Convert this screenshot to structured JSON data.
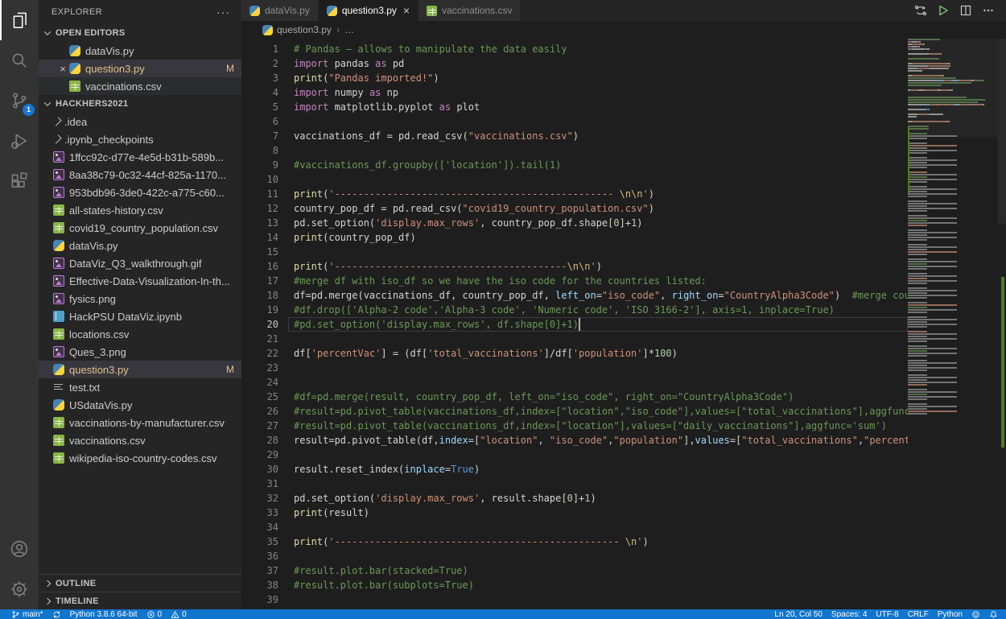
{
  "activity_bar": {
    "items": [
      {
        "name": "explorer",
        "active": true
      },
      {
        "name": "search"
      },
      {
        "name": "source-control",
        "badge": "1"
      },
      {
        "name": "run-debug"
      },
      {
        "name": "extensions"
      }
    ],
    "bottom_items": [
      {
        "name": "account"
      },
      {
        "name": "settings"
      }
    ]
  },
  "sidebar": {
    "title": "EXPLORER",
    "more_actions": "···",
    "open_editors": {
      "label": "OPEN EDITORS",
      "items": [
        {
          "label": "dataVis.py",
          "icon": "python"
        },
        {
          "label": "question3.py",
          "icon": "python",
          "modified": "M",
          "selected": true,
          "close": "×"
        },
        {
          "label": "vaccinations.csv",
          "icon": "csv",
          "hover": true
        }
      ]
    },
    "workspace": {
      "label": "HACKHERS2021",
      "items": [
        {
          "label": ".idea",
          "type": "folder"
        },
        {
          "label": ".ipynb_checkpoints",
          "type": "folder"
        },
        {
          "label": "1ffcc92c-d77e-4e5d-b31b-589b...",
          "icon": "image"
        },
        {
          "label": "8aa38c79-0c32-44cf-825a-1170...",
          "icon": "image"
        },
        {
          "label": "953bdb96-3de0-422c-a775-c60...",
          "icon": "image"
        },
        {
          "label": "all-states-history.csv",
          "icon": "csv"
        },
        {
          "label": "covid19_country_population.csv",
          "icon": "csv"
        },
        {
          "label": "dataVis.py",
          "icon": "python"
        },
        {
          "label": "DataViz_Q3_walkthrough.gif",
          "icon": "image"
        },
        {
          "label": "Effective-Data-Visualization-In-th...",
          "icon": "image"
        },
        {
          "label": "fysics.png",
          "icon": "image"
        },
        {
          "label": "HackPSU DataViz.ipynb",
          "icon": "notebook"
        },
        {
          "label": "locations.csv",
          "icon": "csv"
        },
        {
          "label": "Ques_3.png",
          "icon": "image"
        },
        {
          "label": "question3.py",
          "icon": "python",
          "modified": "M",
          "selected": true
        },
        {
          "label": "test.txt",
          "icon": "text"
        },
        {
          "label": "USdataVis.py",
          "icon": "python"
        },
        {
          "label": "vaccinations-by-manufacturer.csv",
          "icon": "csv"
        },
        {
          "label": "vaccinations.csv",
          "icon": "csv"
        },
        {
          "label": "wikipedia-iso-country-codes.csv",
          "icon": "csv"
        }
      ]
    },
    "outline": {
      "label": "OUTLINE"
    },
    "timeline": {
      "label": "TIMELINE"
    }
  },
  "editor": {
    "tabs": [
      {
        "label": "dataVis.py",
        "icon": "python"
      },
      {
        "label": "question3.py",
        "icon": "python",
        "active": true,
        "close": "×"
      },
      {
        "label": "vaccinations.csv",
        "icon": "csv"
      }
    ],
    "breadcrumb": {
      "file": "question3.py",
      "more": "…"
    },
    "active_line": 20,
    "cursor": {
      "line": 20,
      "col": 50
    },
    "lines": [
      [
        [
          "# Pandas — allows to manipulate the data easily",
          "c"
        ]
      ],
      [
        [
          "import",
          "k"
        ],
        [
          " pandas ",
          "d"
        ],
        [
          "as",
          "k"
        ],
        [
          " pd",
          "d"
        ]
      ],
      [
        [
          "print",
          "f"
        ],
        [
          "(",
          "d"
        ],
        [
          "\"Pandas imported!\"",
          "s"
        ],
        [
          ")",
          "d"
        ]
      ],
      [
        [
          "import",
          "k"
        ],
        [
          " numpy ",
          "d"
        ],
        [
          "as",
          "k"
        ],
        [
          " np",
          "d"
        ]
      ],
      [
        [
          "import",
          "k"
        ],
        [
          " matplotlib.pyplot ",
          "d"
        ],
        [
          "as",
          "k"
        ],
        [
          " plot",
          "d"
        ]
      ],
      [],
      [
        [
          "vaccinations_df = pd.read_csv(",
          "d"
        ],
        [
          "\"vaccinations.csv\"",
          "s"
        ],
        [
          ")",
          "d"
        ]
      ],
      [],
      [
        [
          "#vaccinations_df.groupby(['location']).tail(1)",
          "c"
        ]
      ],
      [],
      [
        [
          "print",
          "f"
        ],
        [
          "(",
          "d"
        ],
        [
          "'------------------------------------------------ ",
          "s"
        ],
        [
          "\\n\\n",
          "e"
        ],
        [
          "'",
          "s"
        ],
        [
          ")",
          "d"
        ]
      ],
      [
        [
          "country_pop_df = pd.read_csv(",
          "d"
        ],
        [
          "\"covid19_country_population.csv\"",
          "s"
        ],
        [
          ")",
          "d"
        ]
      ],
      [
        [
          "pd.set_option(",
          "d"
        ],
        [
          "'display.max_rows'",
          "s"
        ],
        [
          ", country_pop_df.shape[",
          "d"
        ],
        [
          "0",
          "n"
        ],
        [
          "]+",
          "d"
        ],
        [
          "1",
          "n"
        ],
        [
          ")",
          "d"
        ]
      ],
      [
        [
          "print",
          "f"
        ],
        [
          "(country_pop_df)",
          "d"
        ]
      ],
      [],
      [
        [
          "print",
          "f"
        ],
        [
          "(",
          "d"
        ],
        [
          "'----------------------------------------",
          "s"
        ],
        [
          "\\n\\n",
          "e"
        ],
        [
          "'",
          "s"
        ],
        [
          ")",
          "d"
        ]
      ],
      [
        [
          "#merge df with iso_df so we have the iso code for the countries listed:",
          "c"
        ]
      ],
      [
        [
          "df=pd.merge(vaccinations_df, country_pop_df, ",
          "d"
        ],
        [
          "left_on",
          "p"
        ],
        [
          "=",
          "d"
        ],
        [
          "\"iso_code\"",
          "s"
        ],
        [
          ", ",
          "d"
        ],
        [
          "right_on",
          "p"
        ],
        [
          "=",
          "d"
        ],
        [
          "\"CountryAlpha3Code\"",
          "s"
        ],
        [
          ")  ",
          "d"
        ],
        [
          "#merge countries",
          "c"
        ]
      ],
      [
        [
          "#df.drop(['Alpha-2 code','Alpha-3 code', 'Numeric code', 'ISO 3166-2'], axis=1, inplace=True)",
          "c"
        ]
      ],
      [
        [
          "#pd.set_option('display.max_rows', df.shape[0]+1)",
          "c"
        ]
      ],
      [],
      [
        [
          "df[",
          "d"
        ],
        [
          "'percentVac'",
          "s"
        ],
        [
          "] = (df[",
          "d"
        ],
        [
          "'total_vaccinations'",
          "s"
        ],
        [
          "]/df[",
          "d"
        ],
        [
          "'population'",
          "s"
        ],
        [
          "]*",
          "d"
        ],
        [
          "100",
          "n"
        ],
        [
          ")",
          "d"
        ]
      ],
      [],
      [],
      [
        [
          "#df=pd.merge(result, country_pop_df, left_on=\"iso_code\", right_on=\"CountryAlpha3Code\")",
          "c"
        ]
      ],
      [
        [
          "#result=pd.pivot_table(vaccinations_df,index=[\"location\",\"iso_code\"],values=[\"total_vaccinations\"],aggfunc='sum')",
          "c"
        ]
      ],
      [
        [
          "#result=pd.pivot_table(vaccinations_df,index=[\"location\"],values=[\"daily_vaccinations\"],aggfunc='sum')",
          "c"
        ]
      ],
      [
        [
          "result=pd.pivot_table(df,",
          "d"
        ],
        [
          "index",
          "p"
        ],
        [
          "=[",
          "d"
        ],
        [
          "\"location\"",
          "s"
        ],
        [
          ", ",
          "d"
        ],
        [
          "\"iso_code\"",
          "s"
        ],
        [
          ",",
          "d"
        ],
        [
          "\"population\"",
          "s"
        ],
        [
          "],",
          "d"
        ],
        [
          "values",
          "p"
        ],
        [
          "=[",
          "d"
        ],
        [
          "\"total_vaccinations\"",
          "s"
        ],
        [
          ",",
          "d"
        ],
        [
          "\"percentVac\"",
          "s"
        ],
        [
          "])",
          "d"
        ]
      ],
      [],
      [
        [
          "result.reset_index(",
          "d"
        ],
        [
          "inplace",
          "p"
        ],
        [
          "=",
          "d"
        ],
        [
          "True",
          "b"
        ],
        [
          ")",
          "d"
        ]
      ],
      [],
      [
        [
          "pd.set_option(",
          "d"
        ],
        [
          "'display.max_rows'",
          "s"
        ],
        [
          ", result.shape[",
          "d"
        ],
        [
          "0",
          "n"
        ],
        [
          "]+",
          "d"
        ],
        [
          "1",
          "n"
        ],
        [
          ")",
          "d"
        ]
      ],
      [
        [
          "print",
          "f"
        ],
        [
          "(result)",
          "d"
        ]
      ],
      [],
      [
        [
          "print",
          "f"
        ],
        [
          "(",
          "d"
        ],
        [
          "'------------------------------------------------- ",
          "s"
        ],
        [
          "\\n",
          "e"
        ],
        [
          "'",
          "s"
        ],
        [
          ")",
          "d"
        ]
      ],
      [],
      [
        [
          "#result.plot.bar(stacked=True)",
          "c"
        ]
      ],
      [
        [
          "#result.plot.bar(subplots=True)",
          "c"
        ]
      ],
      []
    ]
  },
  "syntax_colors": {
    "d": "#d4d4d4",
    "c": "#6a9955",
    "k": "#c586c0",
    "f": "#dcdcaa",
    "s": "#ce9178",
    "e": "#d7ba7d",
    "p": "#9cdcfe",
    "b": "#569cd6",
    "n": "#b5cea8"
  },
  "status_bar": {
    "background": "#1174cd",
    "left": [
      {
        "icon": "branch",
        "label": "main*"
      },
      {
        "icon": "sync",
        "label": ""
      },
      {
        "label": "Python 3.8.6 64-bit"
      },
      {
        "icon": "error",
        "label": "0"
      },
      {
        "icon": "warning",
        "label": "0"
      }
    ],
    "right": [
      {
        "label": "Ln 20, Col 50"
      },
      {
        "label": "Spaces: 4"
      },
      {
        "label": "UTF-8"
      },
      {
        "label": "CRLF"
      },
      {
        "label": "Python"
      },
      {
        "icon": "feedback",
        "label": ""
      },
      {
        "icon": "bell",
        "label": ""
      }
    ]
  },
  "icons": {
    "explorer": "two-overlapping-documents",
    "search": "magnifier",
    "source-control": "git-branch-nodes",
    "run-debug": "play-with-bug",
    "extensions": "four-squares",
    "account": "person-circle",
    "settings": "gear",
    "loop-arrows": "circular-run-arrows",
    "run": "green-play-triangle",
    "split-editor": "split-rectangle",
    "more": "ellipsis"
  }
}
